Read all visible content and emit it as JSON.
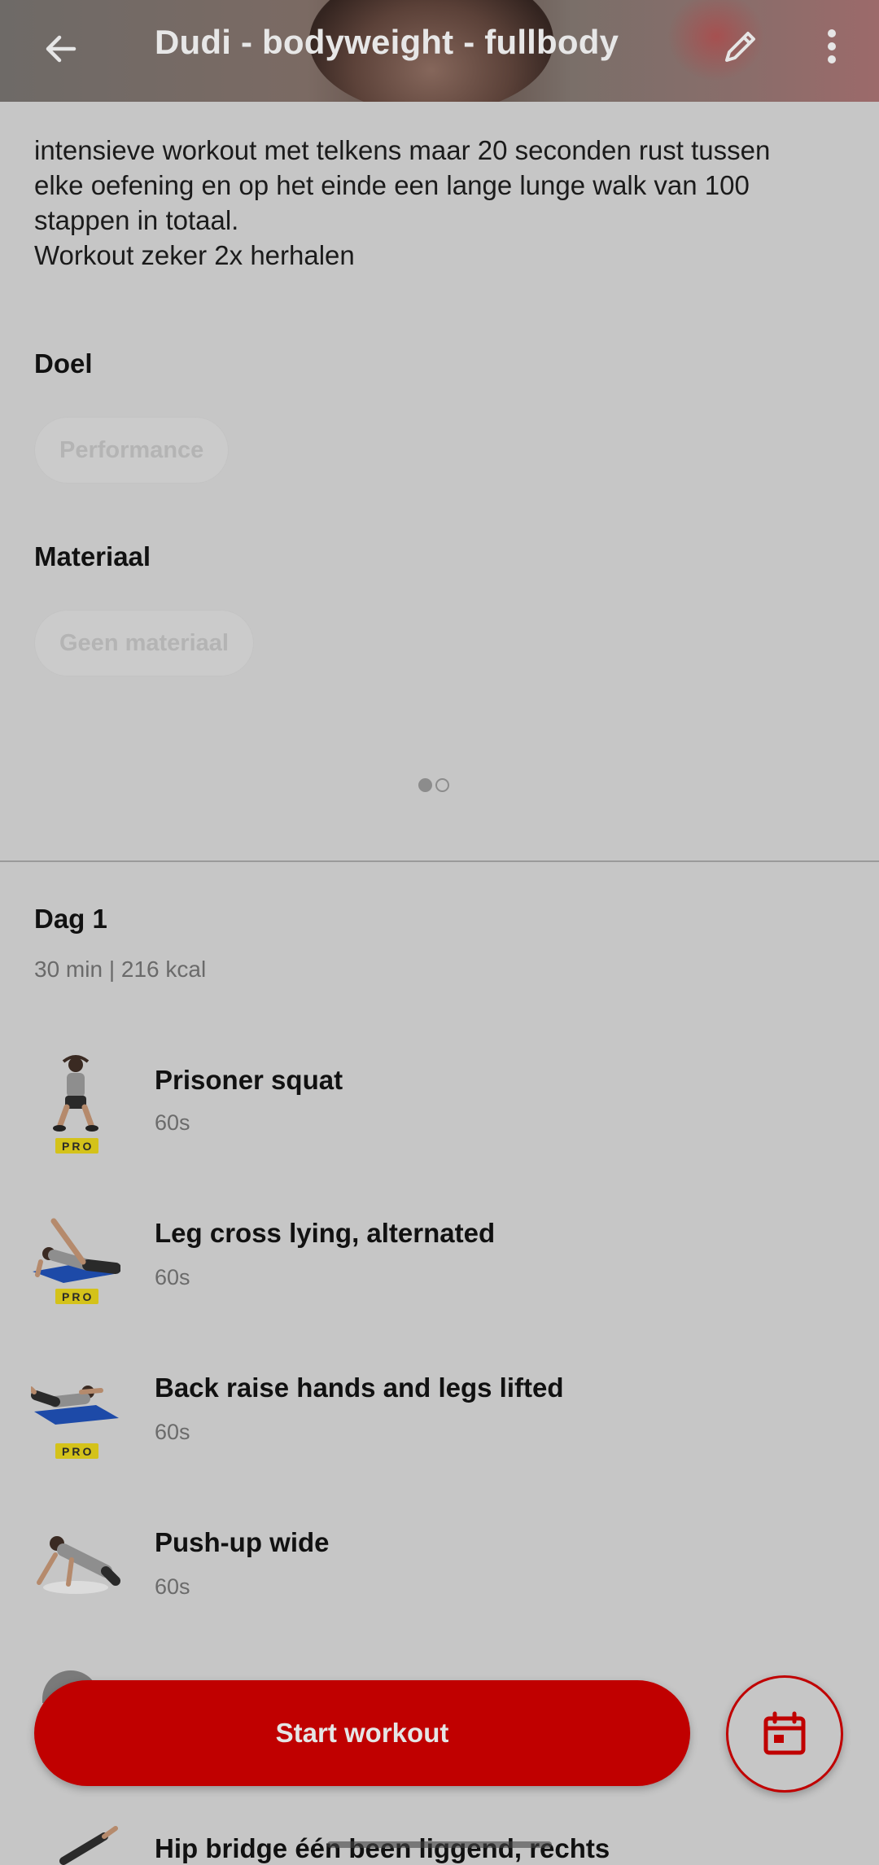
{
  "header": {
    "title": "Dudi - bodyweight - fullbody",
    "back_icon": "arrow-left-icon",
    "edit_icon": "pencil-icon",
    "more_icon": "more-vertical-icon"
  },
  "description": {
    "line1": "intensieve workout met telkens maar 20 seconden rust tussen",
    "line2": "elke oefening en op het einde een lange lunge walk van 100",
    "line3": "stappen in totaal.",
    "line4": "Workout zeker 2x herhalen"
  },
  "goal": {
    "label": "Doel",
    "chip": "Performance"
  },
  "equipment": {
    "label": "Materiaal",
    "chip": "Geen materiaal"
  },
  "pager": {
    "pages": 2,
    "active": 1
  },
  "day": {
    "title": "Dag 1",
    "meta": "30 min | 216 kcal"
  },
  "exercises": [
    {
      "name": "Prisoner squat",
      "duration": "60s",
      "pro": "PRO"
    },
    {
      "name": "Leg cross lying, alternated",
      "duration": "60s",
      "pro": "PRO"
    },
    {
      "name": "Back raise hands and legs lifted",
      "duration": "60s",
      "pro": "PRO"
    },
    {
      "name": "Push-up wide",
      "duration": "60s",
      "pro": ""
    },
    {
      "name": "Hip bridge één been liggend, rechts",
      "duration": "",
      "pro": ""
    }
  ],
  "actions": {
    "start_label": "Start workout",
    "calendar_icon": "calendar-icon"
  },
  "colors": {
    "accent": "#c00000",
    "background": "#c6c6c6",
    "pro_badge": "#d4c21a"
  }
}
